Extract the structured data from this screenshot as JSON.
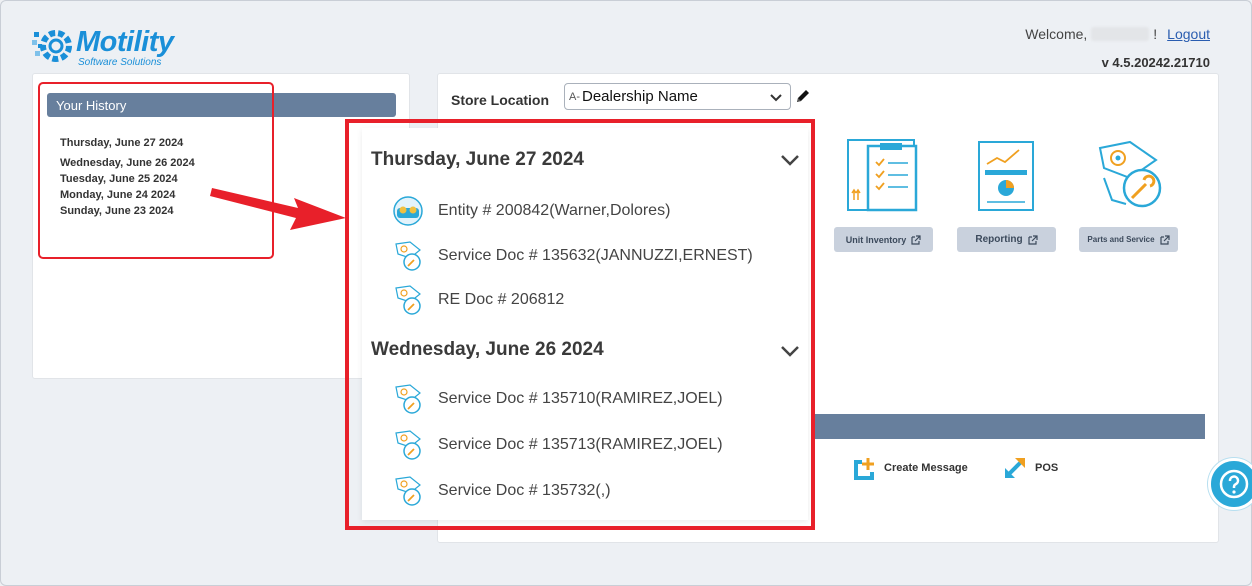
{
  "header": {
    "logo_title": "Motility",
    "logo_sub": "Software Solutions",
    "welcome_prefix": "Welcome,",
    "welcome_suffix": "!",
    "logout": "Logout",
    "version": "v 4.5.20242.21710"
  },
  "history": {
    "title": "Your History",
    "dates": [
      "Thursday, June 27 2024",
      "Wednesday, June 26 2024",
      "Tuesday, June 25 2024",
      "Monday, June 24 2024",
      "Sunday, June 23 2024"
    ]
  },
  "store": {
    "label": "Store Location",
    "prefix": "A-",
    "value": "Dealership Name"
  },
  "tiles": [
    {
      "label": "Unit Inventory"
    },
    {
      "label": "Reporting"
    },
    {
      "label": "Parts and Service"
    }
  ],
  "quick_actions": [
    {
      "label": "Create Message"
    },
    {
      "label": "POS"
    }
  ],
  "dropdown": {
    "groups": [
      {
        "date": "Thursday, June 27 2024",
        "items": [
          {
            "label": "Entity # 200842(Warner,Dolores)",
            "icon": "entity-icon"
          },
          {
            "label": "Service Doc # 135632(JANNUZZI,ERNEST)",
            "icon": "service-doc-icon"
          },
          {
            "label": "RE Doc # 206812",
            "icon": "service-doc-icon"
          }
        ]
      },
      {
        "date": "Wednesday, June 26 2024",
        "items": [
          {
            "label": "Service Doc # 135710(RAMIREZ,JOEL)",
            "icon": "service-doc-icon"
          },
          {
            "label": "Service Doc # 135713(RAMIREZ,JOEL)",
            "icon": "service-doc-icon"
          },
          {
            "label": "Service Doc # 135732(,)",
            "icon": "service-doc-icon"
          }
        ]
      }
    ]
  },
  "colors": {
    "accent": "#1a8fd8",
    "section_bar": "#677f9d",
    "annotation": "#e8202a",
    "help": "#2aa8d8"
  }
}
